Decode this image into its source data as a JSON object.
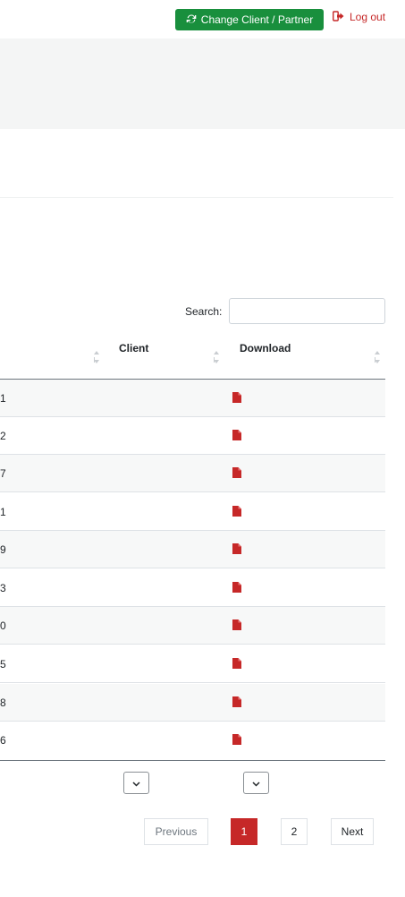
{
  "header": {
    "change_client_label": "Change Client / Partner",
    "logout_label": "Log out",
    "accent_green": "#198f3d",
    "accent_red": "#c62828"
  },
  "search": {
    "label": "Search:",
    "value": ""
  },
  "table": {
    "columns": [
      "Client",
      "Download"
    ],
    "rows": [
      {
        "tail": "1",
        "download_icon": "file-icon"
      },
      {
        "tail": "2",
        "download_icon": "file-icon"
      },
      {
        "tail": "7",
        "download_icon": "file-icon"
      },
      {
        "tail": "1",
        "download_icon": "file-icon"
      },
      {
        "tail": "9",
        "download_icon": "file-icon"
      },
      {
        "tail": "3",
        "download_icon": "file-icon"
      },
      {
        "tail": "0",
        "download_icon": "file-icon"
      },
      {
        "tail": "5",
        "download_icon": "file-icon"
      },
      {
        "tail": "8",
        "download_icon": "file-icon"
      },
      {
        "tail": "6",
        "download_icon": "file-icon"
      }
    ]
  },
  "pagination": {
    "previous_label": "Previous",
    "pages": [
      "1",
      "2"
    ],
    "current_page": "1",
    "next_label": "Next"
  }
}
